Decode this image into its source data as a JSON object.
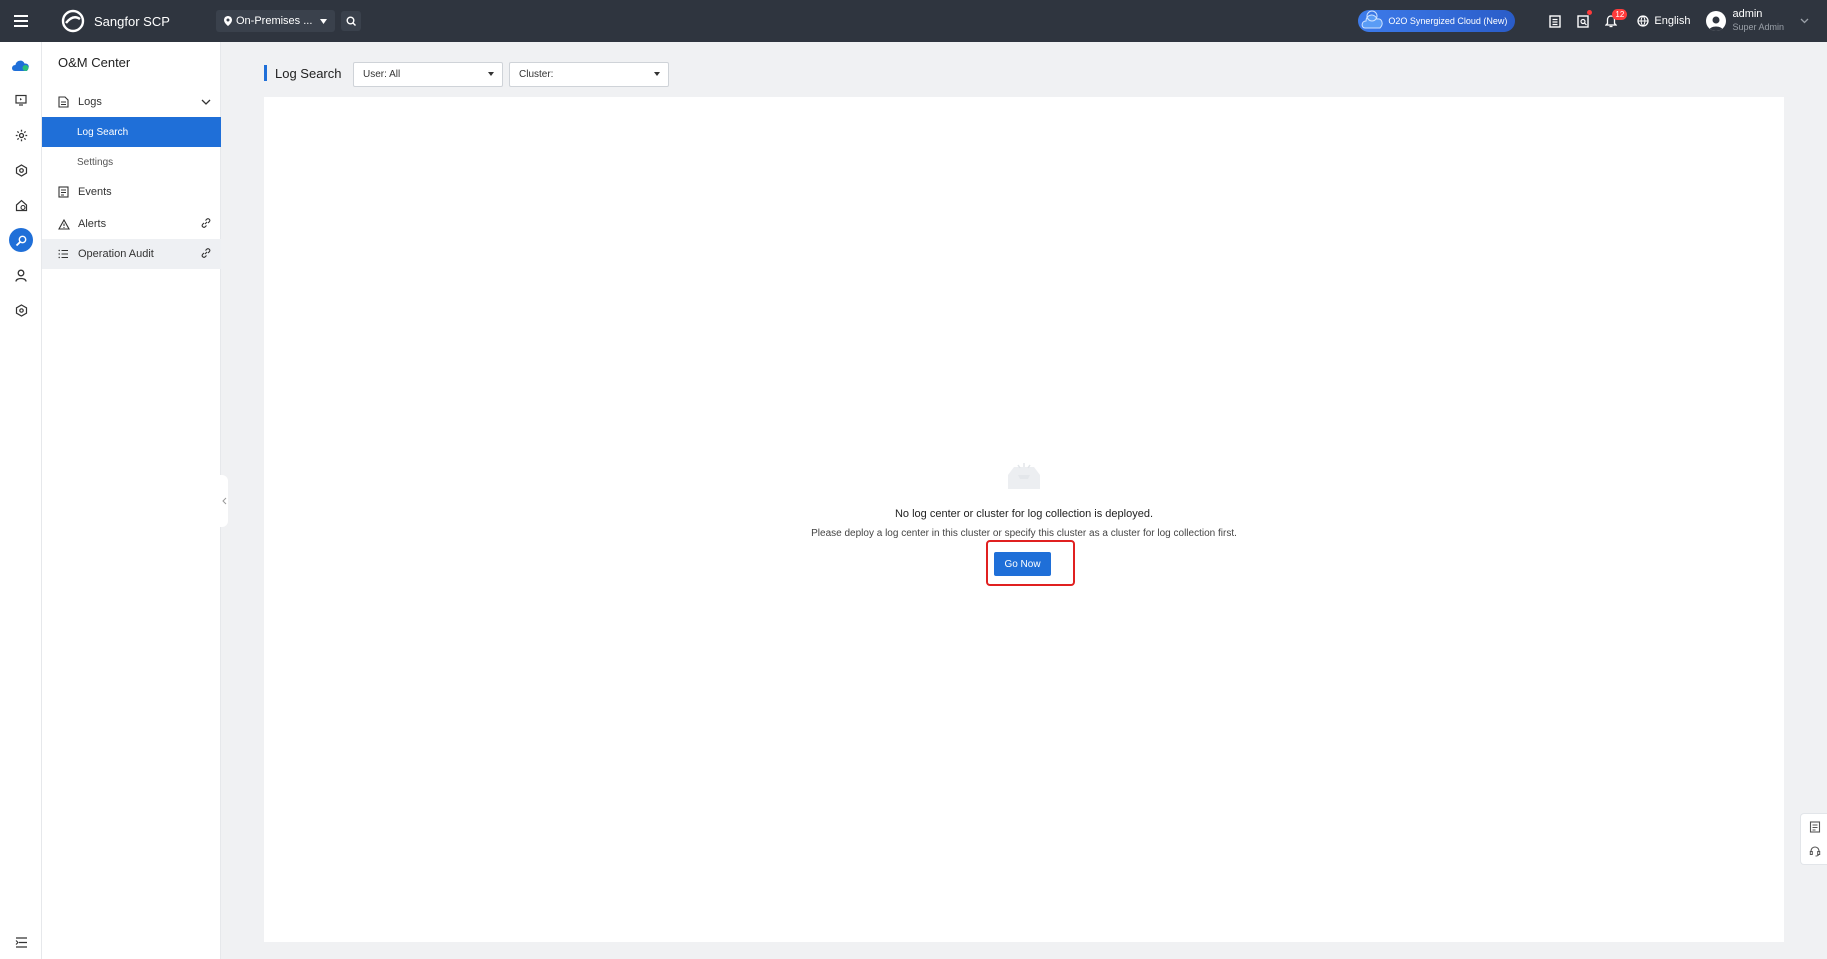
{
  "topbar": {
    "brand": "Sangfor SCP",
    "location": "On-Premises ...",
    "cloud_button": "O2O Synergized Cloud (New)",
    "notification_count": "12",
    "language": "English",
    "user_name": "admin",
    "user_role": "Super Admin"
  },
  "menu": {
    "title": "O&M Center",
    "logs": "Logs",
    "log_search": "Log Search",
    "settings": "Settings",
    "events": "Events",
    "alerts": "Alerts",
    "operation_audit": "Operation Audit"
  },
  "content": {
    "page_title": "Log Search",
    "user_filter": "User: All",
    "cluster_filter": "Cluster:",
    "empty_title": "No log center or cluster for log collection is deployed.",
    "empty_desc": "Please deploy a log center in this cluster or specify this cluster as a cluster for log collection first.",
    "go_button": "Go Now"
  },
  "colors": {
    "topbar": "#2f353f",
    "accent": "#1f6fd8",
    "highlight": "#e02020"
  }
}
